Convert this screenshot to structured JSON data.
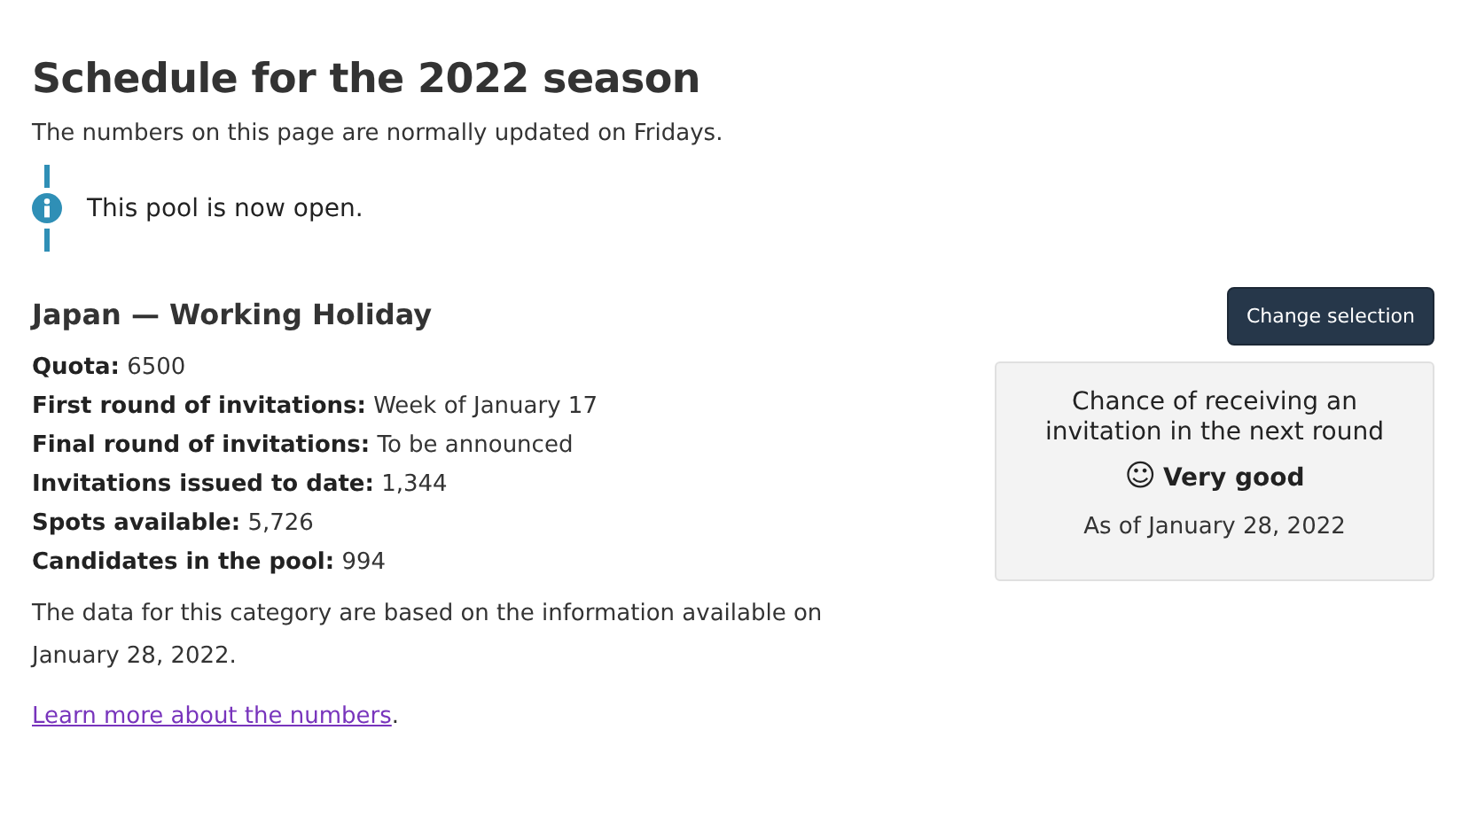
{
  "title": "Schedule for the 2022 season",
  "subtitle": "The numbers on this page are normally updated on Fridays.",
  "notice": {
    "kind": "info",
    "text": "This pool is now open."
  },
  "category": {
    "heading": "Japan — Working Holiday",
    "facts": [
      {
        "label": "Quota:",
        "value": "6500"
      },
      {
        "label": "First round of invitations:",
        "value": "Week of January 17"
      },
      {
        "label": "Final round of invitations:",
        "value": "To be announced"
      },
      {
        "label": "Invitations issued to date:",
        "value": "1,344"
      },
      {
        "label": "Spots available:",
        "value": "5,726"
      },
      {
        "label": "Candidates in the pool:",
        "value": "994"
      }
    ],
    "note": "The data for this category are based on the information available on January 28, 2022.",
    "link": {
      "text": "Learn more about the numbers",
      "after": "."
    }
  },
  "change_button": "Change selection",
  "chance_card": {
    "heading": "Chance of receiving an invitation in the next round",
    "rating_symbol": "☺",
    "rating": "Very good",
    "as_of": "As of January 28, 2022"
  }
}
